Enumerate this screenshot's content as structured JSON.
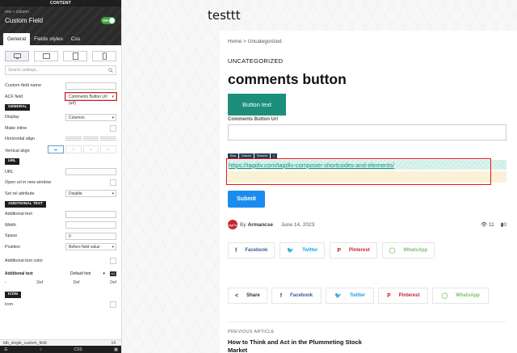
{
  "panel": {
    "top_label": "CONTENT",
    "breadcrumb": "row > column",
    "title": "Custom Field",
    "toggle": "ON",
    "tabs": [
      "General",
      "Fields styles",
      "Css"
    ],
    "search_placeholder": "Search settings...",
    "custom_field_name_label": "Custom field name",
    "acf_label": "ACF field",
    "acf_value": "Comments Button Url (url)",
    "sections": {
      "general": "GENERAL",
      "url": "URL",
      "additional_text": "ADDITIONAL TEXT",
      "icon": "ICON"
    },
    "display_label": "Display",
    "display_value": "Columns",
    "make_inline_label": "Make inline",
    "horizontal_align_label": "Horizontal align",
    "vertical_align_label": "Vertical align",
    "url_label": "URL",
    "open_new_window_label": "Open url in new window",
    "rel_label": "Set rel attribute",
    "rel_value": "Disable",
    "additional_text_label": "Additional text",
    "width_label": "Width",
    "space_label": "Space",
    "space_value": "0",
    "position_label": "Position",
    "position_value": "Before field value",
    "additional_text_color_label": "Additional text color",
    "font_label": "Additional text",
    "font_value": "Default font",
    "defaults": [
      "-",
      "Def",
      "Def",
      "Def"
    ],
    "icon_label": "Icon",
    "bottom_code": "tdb_single_custom_field",
    "bottom_num": "14",
    "footer_css": "CSS"
  },
  "page": {
    "site_title": "testtt",
    "breadcrumb": "Home  >  Uncategorized",
    "category": "UNCATEGORIZED",
    "title": "comments button",
    "button_text": "Button text",
    "comments_button_label": "Comments Button Url",
    "toolbar": [
      "Row",
      "Column",
      "Element",
      "×"
    ],
    "link_url": "https://tagdiv.com/tagdiv-composer-shortcodes-and-elements/",
    "submit": "Submit",
    "avatar_text": "tagDiv",
    "by": "By",
    "author": "Armancse",
    "date": "June 14, 2023",
    "views": "11",
    "comments": "0",
    "share_row1": [
      "Facebook",
      "Twitter",
      "Pinterest",
      "WhatsApp"
    ],
    "share_label": "Share",
    "share_row2": [
      "Facebook",
      "Twitter",
      "Pinterest",
      "WhatsApp"
    ],
    "previous_label": "PREVIOUS ARTICLE",
    "previous_title": "How to Think and Act in the Plummeting Stock Market"
  },
  "colors": {
    "accent_teal": "#1c8f7a",
    "submit_blue": "#1a8cf0",
    "highlight_red": "#e0191b",
    "panel_dark": "#1e1e1e"
  }
}
